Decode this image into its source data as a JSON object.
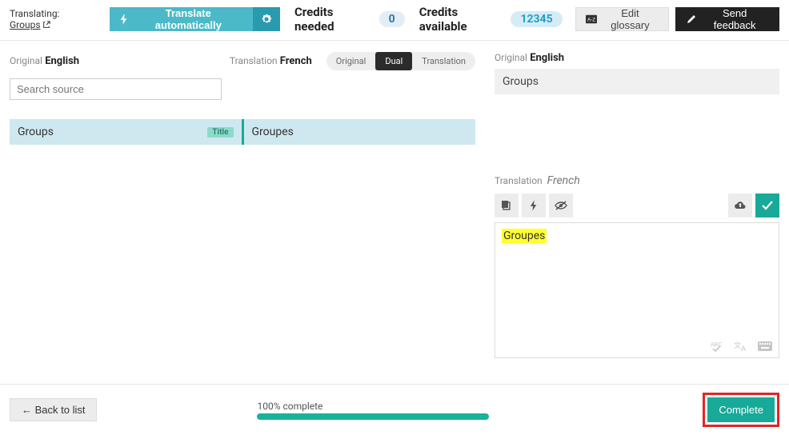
{
  "topbar": {
    "translating_label": "Translating:",
    "translating_link": "Groups",
    "translate_auto": "Translate automatically",
    "credits_needed_label": "Credits needed",
    "credits_needed_value": "0",
    "credits_available_label": "Credits available",
    "credits_available_value": "12345",
    "edit_glossary": "Edit glossary",
    "send_feedback": "Send feedback"
  },
  "list": {
    "original_label": "Original",
    "original_lang": "English",
    "translation_label": "Translation",
    "translation_lang": "French",
    "toggle": {
      "original": "Original",
      "dual": "Dual",
      "translation": "Translation"
    },
    "search_placeholder": "Search source",
    "row": {
      "source": "Groups",
      "tag": "Title",
      "target": "Groupes"
    }
  },
  "detail": {
    "original_label": "Original",
    "original_lang": "English",
    "original_text": "Groups",
    "translation_label": "Translation",
    "translation_lang": "French",
    "editor_text": "Groupes"
  },
  "footer": {
    "back": "← Back to list",
    "progress_label": "100% complete",
    "complete": "Complete"
  }
}
